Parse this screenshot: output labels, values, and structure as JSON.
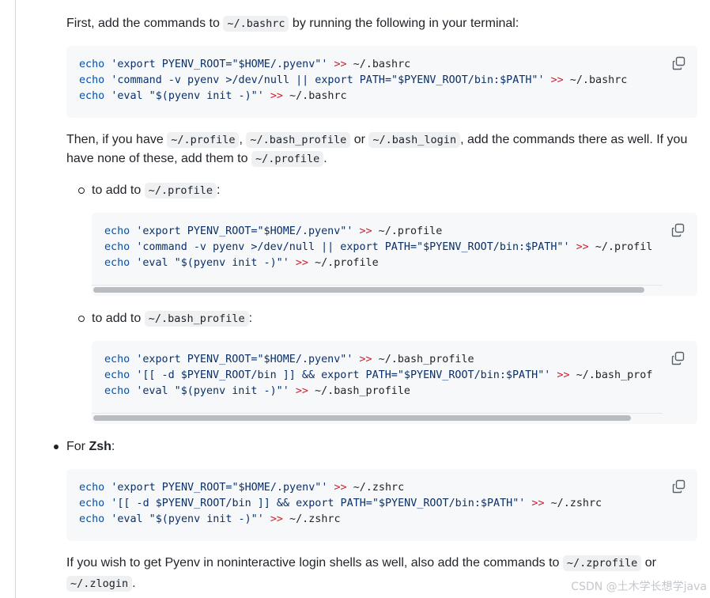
{
  "para1": {
    "before": "First, add the commands to ",
    "code": "~/.bashrc",
    "after": " by running the following in your terminal:"
  },
  "block1": [
    [
      "echo",
      " ",
      "'export PYENV_ROOT=\"$HOME/.pyenv\"'",
      " ",
      ">>",
      " ~/.bashrc"
    ],
    [
      "echo",
      " ",
      "'command -v pyenv >/dev/null || export PATH=\"$PYENV_ROOT/bin:$PATH\"'",
      " ",
      ">>",
      " ~/.bashrc"
    ],
    [
      "echo",
      " ",
      "'eval \"$(pyenv init -)\"'",
      " ",
      ">>",
      " ~/.bashrc"
    ]
  ],
  "para2": {
    "t1": "Then, if you have ",
    "c1": "~/.profile",
    "t2": ", ",
    "c2": "~/.bash_profile",
    "t3": " or ",
    "c3": "~/.bash_login",
    "t4": ", add the commands there as well. If you",
    "t5": "have none of these, add them to ",
    "c4": "~/.profile",
    "t6": "."
  },
  "item_profile": {
    "before": "to add to ",
    "code": "~/.profile",
    "after": ":"
  },
  "block2": [
    [
      "echo",
      " ",
      "'export PYENV_ROOT=\"$HOME/.pyenv\"'",
      " ",
      ">>",
      " ~/.profile"
    ],
    [
      "echo",
      " ",
      "'command -v pyenv >/dev/null || export PATH=\"$PYENV_ROOT/bin:$PATH\"'",
      " ",
      ">>",
      " ~/.profil"
    ],
    [
      "echo",
      " ",
      "'eval \"$(pyenv init -)\"'",
      " ",
      ">>",
      " ~/.profile"
    ]
  ],
  "item_bash_profile": {
    "before": "to add to ",
    "code": "~/.bash_profile",
    "after": ":"
  },
  "block3": [
    [
      "echo",
      " ",
      "'export PYENV_ROOT=\"$HOME/.pyenv\"'",
      " ",
      ">>",
      " ~/.bash_profile"
    ],
    [
      "echo",
      " ",
      "'[[ -d $PYENV_ROOT/bin ]] && export PATH=\"$PYENV_ROOT/bin:$PATH\"'",
      " ",
      ">>",
      " ~/.bash_prof"
    ],
    [
      "echo",
      " ",
      "'eval \"$(pyenv init -)\"'",
      " ",
      ">>",
      " ~/.bash_profile"
    ]
  ],
  "item_zsh": {
    "before": "For ",
    "bold": "Zsh",
    "after": ":"
  },
  "block4": [
    [
      "echo",
      " ",
      "'export PYENV_ROOT=\"$HOME/.pyenv\"'",
      " ",
      ">>",
      " ~/.zshrc"
    ],
    [
      "echo",
      " ",
      "'[[ -d $PYENV_ROOT/bin ]] && export PATH=\"$PYENV_ROOT/bin:$PATH\"'",
      " ",
      ">>",
      " ~/.zshrc"
    ],
    [
      "echo",
      " ",
      "'eval \"$(pyenv init -)\"'",
      " ",
      ">>",
      " ~/.zshrc"
    ]
  ],
  "para3": {
    "t1": "If you wish to get Pyenv in noninteractive login shells as well, also add the commands to ",
    "c1": "~/.zprofile",
    "t2": " or",
    "c2": "~/.zlogin",
    "t3": "."
  },
  "watermark": "CSDN @土木学长想学java",
  "icons": {
    "copy": "copy-icon"
  }
}
